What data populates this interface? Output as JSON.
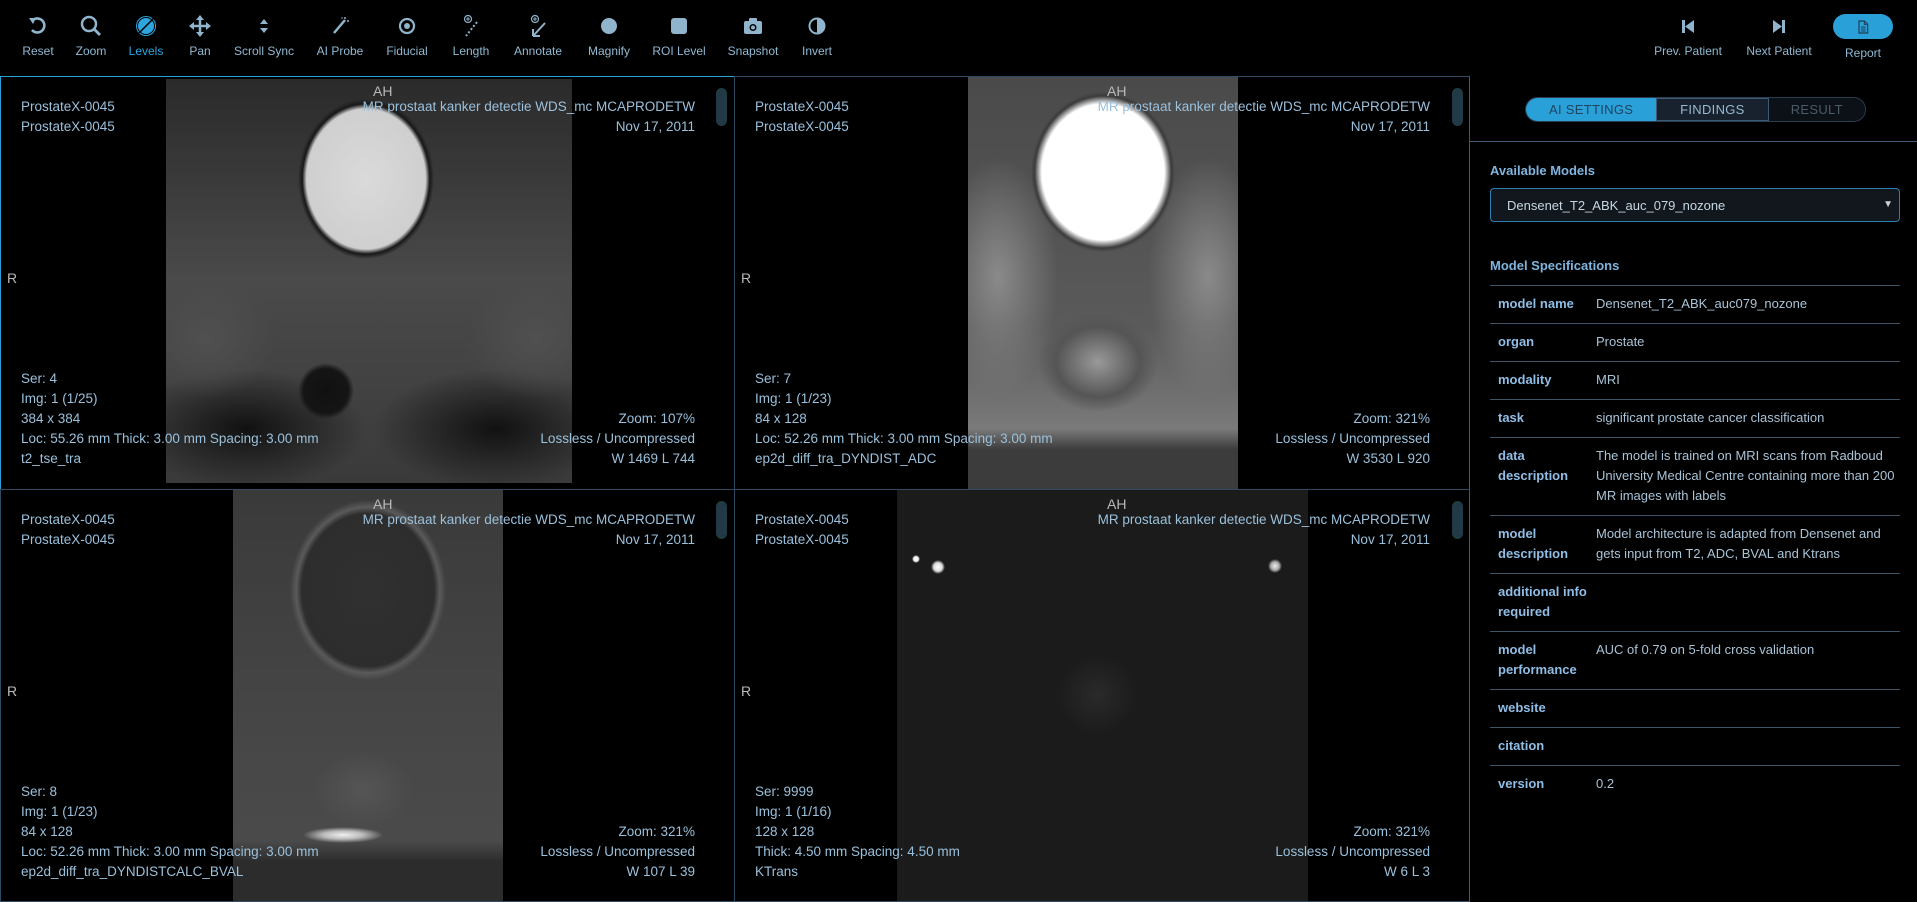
{
  "toolbar": {
    "tools": [
      {
        "label": "Reset",
        "icon": "reset-icon"
      },
      {
        "label": "Zoom",
        "icon": "zoom-icon"
      },
      {
        "label": "Levels",
        "icon": "levels-icon",
        "active": true
      },
      {
        "label": "Pan",
        "icon": "pan-icon"
      },
      {
        "label": "Scroll Sync",
        "icon": "scroll-sync-icon"
      },
      {
        "label": "AI Probe",
        "icon": "ai-probe-icon"
      },
      {
        "label": "Fiducial",
        "icon": "fiducial-icon"
      },
      {
        "label": "Length",
        "icon": "length-icon"
      },
      {
        "label": "Annotate",
        "icon": "annotate-icon"
      },
      {
        "label": "Magnify",
        "icon": "magnify-icon"
      },
      {
        "label": "ROI Level",
        "icon": "roi-level-icon"
      },
      {
        "label": "Snapshot",
        "icon": "camera-icon"
      },
      {
        "label": "Invert",
        "icon": "invert-icon"
      }
    ],
    "prev_patient": "Prev. Patient",
    "next_patient": "Next Patient",
    "report": "Report"
  },
  "viewports": [
    {
      "patient_id": "ProstateX-0045",
      "patient_name": "ProstateX-0045",
      "study": "MR prostaat kanker detectie WDS_mc MCAPRODETW",
      "date": "Nov 17, 2011",
      "orient_top": "AH",
      "orient_left": "R",
      "series": "Ser: 4",
      "image": "Img: 1 (1/25)",
      "matrix": "384 x 384",
      "location": "Loc: 55.26 mm Thick: 3.00 mm Spacing: 3.00 mm",
      "description": "t2_tse_tra",
      "zoom": "Zoom: 107%",
      "compression": "Lossless / Uncompressed",
      "window_level": "W 1469 L 744"
    },
    {
      "patient_id": "ProstateX-0045",
      "patient_name": "ProstateX-0045",
      "study": "MR prostaat kanker detectie WDS_mc MCAPRODETW",
      "date": "Nov 17, 2011",
      "orient_top": "AH",
      "orient_left": "R",
      "series": "Ser: 7",
      "image": "Img: 1 (1/23)",
      "matrix": "84 x 128",
      "location": "Loc: 52.26 mm Thick: 3.00 mm Spacing: 3.00 mm",
      "description": "ep2d_diff_tra_DYNDIST_ADC",
      "zoom": "Zoom: 321%",
      "compression": "Lossless / Uncompressed",
      "window_level": "W 3530 L 920"
    },
    {
      "patient_id": "ProstateX-0045",
      "patient_name": "ProstateX-0045",
      "study": "MR prostaat kanker detectie WDS_mc MCAPRODETW",
      "date": "Nov 17, 2011",
      "orient_top": "AH",
      "orient_left": "R",
      "series": "Ser: 8",
      "image": "Img: 1 (1/23)",
      "matrix": "84 x 128",
      "location": "Loc: 52.26 mm Thick: 3.00 mm Spacing: 3.00 mm",
      "description": "ep2d_diff_tra_DYNDISTCALC_BVAL",
      "zoom": "Zoom: 321%",
      "compression": "Lossless / Uncompressed",
      "window_level": "W 107 L 39"
    },
    {
      "patient_id": "ProstateX-0045",
      "patient_name": "ProstateX-0045",
      "study": "MR prostaat kanker detectie WDS_mc MCAPRODETW",
      "date": "Nov 17, 2011",
      "orient_top": "AH",
      "orient_left": "R",
      "series": "Ser: 9999",
      "image": "Img: 1 (1/16)",
      "matrix": "128 x 128",
      "location": "Thick: 4.50 mm Spacing: 4.50 mm",
      "description": "KTrans",
      "zoom": "Zoom: 321%",
      "compression": "Lossless / Uncompressed",
      "window_level": "W 6 L 3"
    }
  ],
  "panel": {
    "tabs": [
      {
        "label": "AI SETTINGS",
        "state": "active"
      },
      {
        "label": "FINDINGS",
        "state": "normal"
      },
      {
        "label": "RESULT",
        "state": "disabled"
      }
    ],
    "available_models_label": "Available Models",
    "selected_model": "Densenet_T2_ABK_auc_079_nozone",
    "specs_title": "Model Specifications",
    "specs": [
      {
        "key": "model name",
        "value": "Densenet_T2_ABK_auc079_nozone"
      },
      {
        "key": "organ",
        "value": "Prostate"
      },
      {
        "key": "modality",
        "value": "MRI"
      },
      {
        "key": "task",
        "value": "significant prostate cancer classification"
      },
      {
        "key": "data description",
        "value": "The model is trained on MRI scans from Radboud University Medical Centre containing more than 200 MR images with labels"
      },
      {
        "key": "model description",
        "value": "Model architecture is adapted from Densenet and gets input from T2, ADC, BVAL and Ktrans"
      },
      {
        "key": "additional info required",
        "value": ""
      },
      {
        "key": "model performance",
        "value": "AUC of 0.79 on 5-fold cross validation"
      },
      {
        "key": "website",
        "value": ""
      },
      {
        "key": "citation",
        "value": ""
      },
      {
        "key": "version",
        "value": "0.2"
      }
    ]
  },
  "colors": {
    "accent": "#2aa0d8",
    "text": "#9ac0db",
    "border": "#2f4a62"
  }
}
